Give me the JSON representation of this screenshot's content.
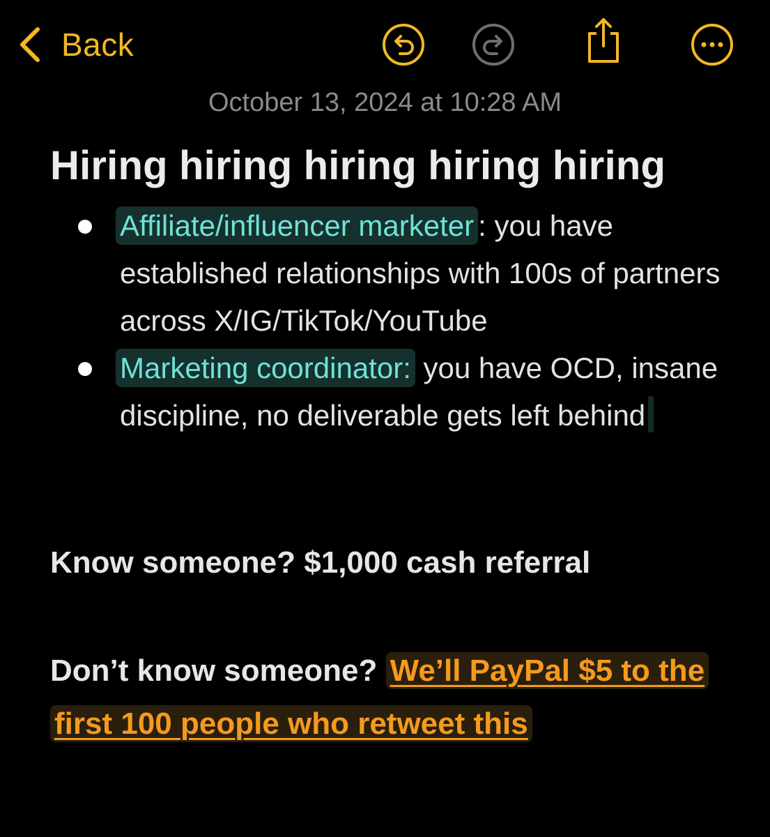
{
  "toolbar": {
    "back_label": "Back",
    "icons": [
      "chevron-left-icon",
      "undo-icon",
      "redo-icon",
      "share-icon",
      "more-icon"
    ]
  },
  "colors": {
    "accent": "#f2b823",
    "background": "#000000",
    "timestamp": "#8b8b8e",
    "role_highlight_text": "#6de3d6",
    "role_highlight_bg": "#16302e",
    "link_text": "#f59a1e",
    "link_bg": "#2a1f0d",
    "redo_disabled": "#6e6e6e"
  },
  "note": {
    "timestamp": "October 13, 2024 at 10:28 AM",
    "title": "Hiring hiring hiring hiring hiring",
    "bullets": [
      {
        "role": "Affiliate/influencer marketer",
        "description": ": you have established relationships with 100s of partners across X/IG/TikTok/YouTube"
      },
      {
        "role": "Marketing coordinator:",
        "description": " you have OCD, insane discipline, no deliverable gets left behind"
      }
    ],
    "referral": "Know someone? $1,000 cash referral",
    "dont_know_prefix": "Don’t know someone? ",
    "dont_know_link": "We’ll PayPal $5 to the first 100 people who retweet this"
  }
}
